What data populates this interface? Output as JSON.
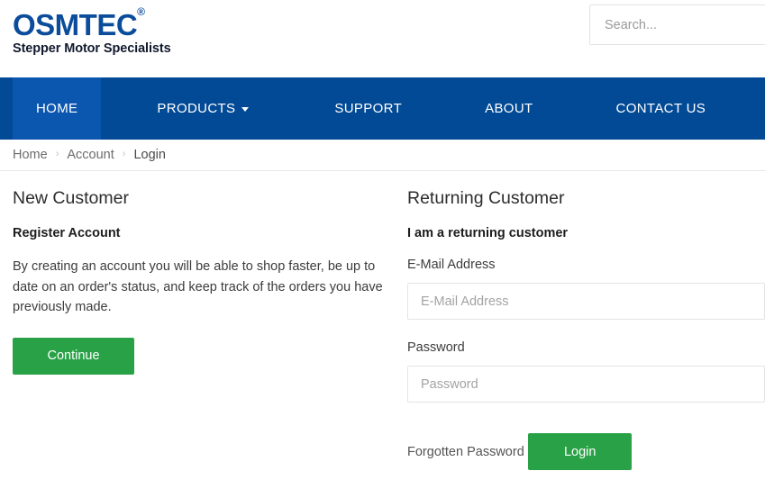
{
  "header": {
    "logo_word": "OSMTEC",
    "logo_registered": "®",
    "logo_tagline": "Stepper Motor Specialists",
    "search": {
      "value": "",
      "placeholder": "Search..."
    }
  },
  "nav": {
    "items": [
      {
        "label": "HOME",
        "active": true,
        "caret": false
      },
      {
        "label": "PRODUCTS",
        "active": false,
        "caret": true
      },
      {
        "label": "SUPPORT",
        "active": false,
        "caret": false
      },
      {
        "label": "ABOUT",
        "active": false,
        "caret": false
      },
      {
        "label": "CONTACT US",
        "active": false,
        "caret": false
      }
    ]
  },
  "breadcrumb": {
    "separator": "›",
    "items": [
      {
        "label": "Home"
      },
      {
        "label": "Account"
      },
      {
        "label": "Login"
      }
    ]
  },
  "new_customer": {
    "title": "New Customer",
    "subtitle": "Register Account",
    "description": "By creating an account you will be able to shop faster, be up to date on an order's status, and keep track of the orders you have previously made.",
    "continue_label": "Continue"
  },
  "returning_customer": {
    "title": "Returning Customer",
    "subtitle": "I am a returning customer",
    "email_label": "E-Mail Address",
    "email_value": "",
    "email_placeholder": "E-Mail Address",
    "password_label": "Password",
    "password_value": "",
    "password_placeholder": "Password",
    "forgotten_password_label": "Forgotten Password",
    "login_label": "Login"
  },
  "colors": {
    "brand_blue": "#024a95",
    "nav_active_blue": "#0b56ae",
    "logo_blue": "#0b4c9b",
    "accent_green": "#29a247",
    "border_grey": "#e4e4e4"
  }
}
